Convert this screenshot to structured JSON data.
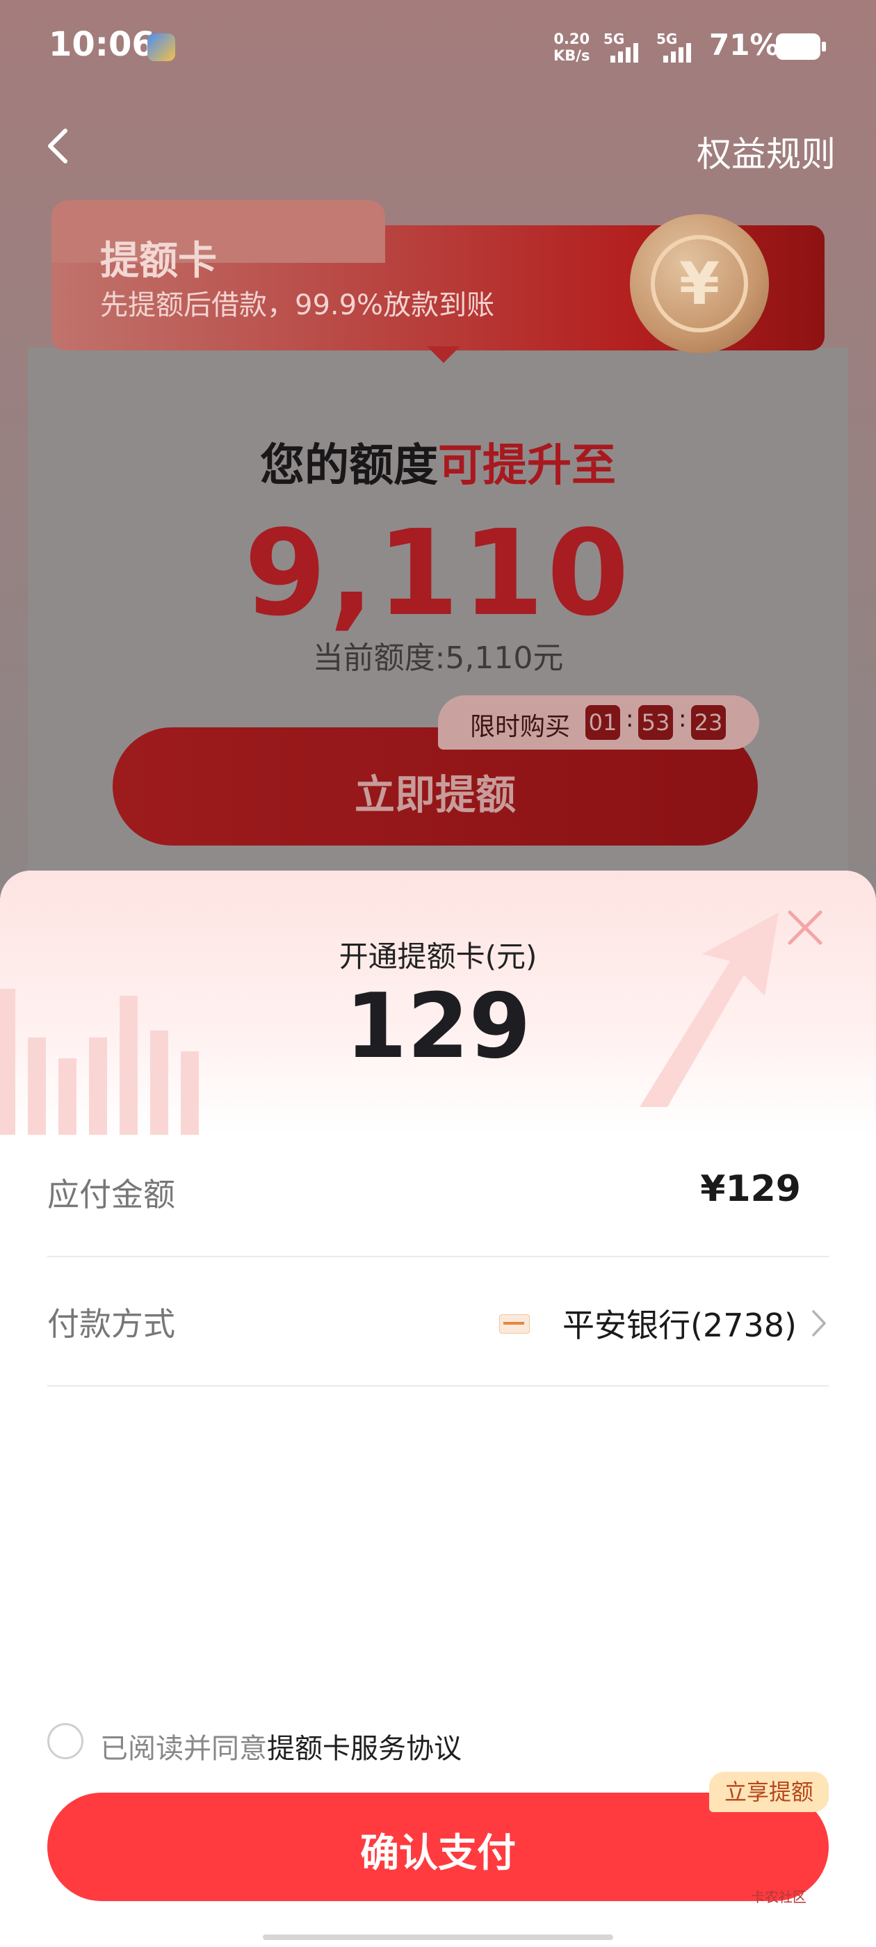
{
  "status_bar": {
    "time": "10:06",
    "net_speed_value": "0.20",
    "net_speed_unit": "KB/s",
    "signal1_tag": "5G",
    "signal2_tag": "5G",
    "battery_percent": "71%",
    "battery_level": 0.71
  },
  "header": {
    "back_icon": "chevron-left-icon",
    "rules_label": "权益规则"
  },
  "banner": {
    "title": "提额卡",
    "subtitle": "先提额后借款，99.9%放款到账",
    "coin_symbol": "¥"
  },
  "limit": {
    "heading_prefix": "您的额度",
    "heading_highlight": "可提升至",
    "amount": "9,110",
    "current": "当前额度:5,110元",
    "boost_button": "立即提额",
    "timer_label": "限时购买",
    "timer_hours": "01",
    "timer_minutes": "53",
    "timer_seconds": "23",
    "timer_sep": ":"
  },
  "sheet": {
    "title": "开通提额卡(元)",
    "price": "129",
    "rows": [
      {
        "label": "应付金额",
        "value": "¥129"
      },
      {
        "label": "付款方式",
        "value": "平安银行(2738)"
      }
    ],
    "agree_prefix": "已阅读并同意",
    "agree_link": "提额卡服务协议",
    "pay_button": "确认支付",
    "pay_badge": "立享提额"
  },
  "watermark": "卡农社区",
  "colors": {
    "primary_red": "#ff3b3f",
    "dark_red": "#a71d22",
    "badge_bg": "#ffe4b8"
  }
}
